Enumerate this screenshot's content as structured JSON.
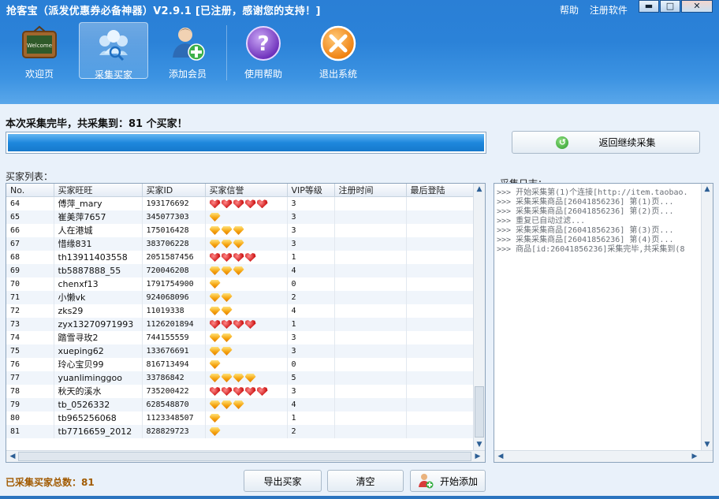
{
  "window": {
    "title": "抢客宝（派发优惠券必备神器）V2.9.1 [已注册，感谢您的支持！]",
    "help_link": "帮助",
    "register_link": "注册软件",
    "minimize": "▬",
    "maximize": "□",
    "close": "✕"
  },
  "toolbar": [
    {
      "label": "欢迎页",
      "icon": "welcome-board-icon"
    },
    {
      "label": "采集买家",
      "icon": "collect-buyers-icon",
      "active": true
    },
    {
      "label": "添加会员",
      "icon": "add-member-icon"
    },
    {
      "label": "使用帮助",
      "icon": "help-icon"
    },
    {
      "label": "退出系统",
      "icon": "exit-icon"
    }
  ],
  "welcome_sign": "Welcome",
  "status_text": "本次采集完毕，共采集到：81 个买家！",
  "progress_percent": 100,
  "back_button": "返回继续采集",
  "buyer_list_label": "买家列表：",
  "log_label": "采集日志：",
  "columns": [
    "No.",
    "买家旺旺",
    "买家ID",
    "买家信誉",
    "VIP等级",
    "注册时间",
    "最后登陆"
  ],
  "rows": [
    {
      "no": "64",
      "name": "傅萍_mary",
      "id": "193176692",
      "rep": "heart",
      "count": 5,
      "vip": "3"
    },
    {
      "no": "65",
      "name": "崔美萍7657",
      "id": "345077303",
      "rep": "diamond",
      "count": 1,
      "vip": "3"
    },
    {
      "no": "66",
      "name": "人在港城",
      "id": "175016428",
      "rep": "diamond",
      "count": 3,
      "vip": "3"
    },
    {
      "no": "67",
      "name": "惜缘831",
      "id": "383706228",
      "rep": "diamond",
      "count": 3,
      "vip": "3"
    },
    {
      "no": "68",
      "name": "th13911403558",
      "id": "2051587456",
      "rep": "heart",
      "count": 4,
      "vip": "1"
    },
    {
      "no": "69",
      "name": "tb5887888_55",
      "id": "720046208",
      "rep": "diamond",
      "count": 3,
      "vip": "4"
    },
    {
      "no": "70",
      "name": "chenxf13",
      "id": "1791754900",
      "rep": "diamond",
      "count": 1,
      "vip": "0"
    },
    {
      "no": "71",
      "name": "小懒vk",
      "id": "924068096",
      "rep": "diamond",
      "count": 2,
      "vip": "2"
    },
    {
      "no": "72",
      "name": "zks29",
      "id": "11019338",
      "rep": "diamond",
      "count": 2,
      "vip": "4"
    },
    {
      "no": "73",
      "name": "zyx13270971993",
      "id": "1126201894",
      "rep": "heart",
      "count": 4,
      "vip": "1"
    },
    {
      "no": "74",
      "name": "踏雪寻玫2",
      "id": "744155559",
      "rep": "diamond",
      "count": 2,
      "vip": "3"
    },
    {
      "no": "75",
      "name": "xueping62",
      "id": "133676691",
      "rep": "diamond",
      "count": 2,
      "vip": "3"
    },
    {
      "no": "76",
      "name": "玲心宝贝99",
      "id": "816713494",
      "rep": "diamond",
      "count": 1,
      "vip": "0"
    },
    {
      "no": "77",
      "name": "yuanliminggoo",
      "id": "33786842",
      "rep": "diamond",
      "count": 4,
      "vip": "5"
    },
    {
      "no": "78",
      "name": "秋天的溪水",
      "id": "735200422",
      "rep": "heart",
      "count": 5,
      "vip": "3"
    },
    {
      "no": "79",
      "name": "tb_0526332",
      "id": "628548870",
      "rep": "diamond",
      "count": 3,
      "vip": "4"
    },
    {
      "no": "80",
      "name": "tb965256068",
      "id": "1123348507",
      "rep": "diamond",
      "count": 1,
      "vip": "1"
    },
    {
      "no": "81",
      "name": "tb7716659_2012",
      "id": "828829723",
      "rep": "diamond",
      "count": 1,
      "vip": "2"
    }
  ],
  "log_lines": [
    ">>> 开始采集第(1)个连接[http://item.taobao.",
    ">>> 采集采集商品[26041856236] 第(1)页...",
    ">>> 采集采集商品[26041856236] 第(2)页...",
    ">>> 重复已自动过滤...",
    ">>> 采集采集商品[26041856236] 第(3)页...",
    ">>> 采集采集商品[26041856236] 第(4)页...",
    ">>> 商品[id:26041856236]采集完毕,共采集到(8"
  ],
  "total_label": "已采集买家总数：81",
  "bottom_buttons": {
    "export": "导出买家",
    "clear": "清空",
    "start_add": "开始添加"
  }
}
